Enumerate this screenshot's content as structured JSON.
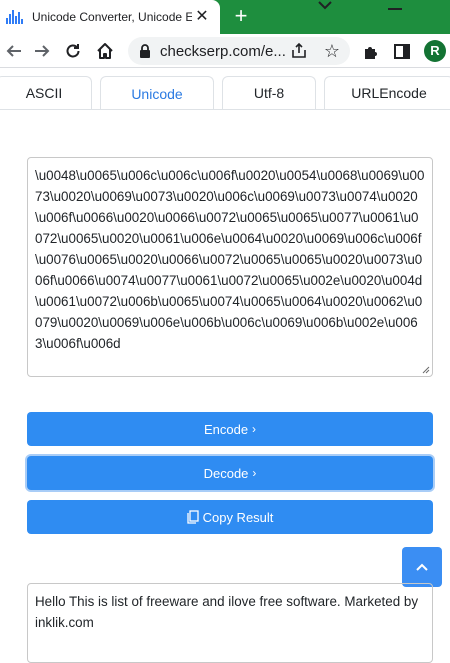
{
  "browser": {
    "tab_title": "Unicode Converter, Unicode E",
    "url": "checkserp.com/e...",
    "new_tab_symbol": "+",
    "close_symbol": "✕",
    "avatar_initial": "R",
    "star_symbol": "☆"
  },
  "nav_tabs": [
    {
      "label": "ASCII",
      "active": false
    },
    {
      "label": "Unicode",
      "active": true
    },
    {
      "label": "Utf-8",
      "active": false
    },
    {
      "label": "URLEncode",
      "active": false
    }
  ],
  "input": {
    "value": "\\u0048\\u0065\\u006c\\u006c\\u006f\\u0020\\u0054\\u0068\\u0069\\u0073\\u0020\\u0069\\u0073\\u0020\\u006c\\u0069\\u0073\\u0074\\u0020\\u006f\\u0066\\u0020\\u0066\\u0072\\u0065\\u0065\\u0077\\u0061\\u0072\\u0065\\u0020\\u0061\\u006e\\u0064\\u0020\\u0069\\u006c\\u006f\\u0076\\u0065\\u0020\\u0066\\u0072\\u0065\\u0065\\u0020\\u0073\\u006f\\u0066\\u0074\\u0077\\u0061\\u0072\\u0065\\u002e\\u0020\\u004d\\u0061\\u0072\\u006b\\u0065\\u0074\\u0065\\u0064\\u0020\\u0062\\u0079\\u0020\\u0069\\u006e\\u006b\\u006c\\u0069\\u006b\\u002e\\u0063\\u006f\\u006d"
  },
  "buttons": {
    "encode": "Encode",
    "decode": "Decode",
    "copy": "Copy Result",
    "chevron": "›"
  },
  "output": {
    "value": "Hello This is list of freeware and ilove free software. Marketed by inklik.com"
  },
  "colors": {
    "accent": "#2f8cf2",
    "active_tab_text": "#2a7ae2",
    "tabstrip": "#1e8e3e"
  }
}
